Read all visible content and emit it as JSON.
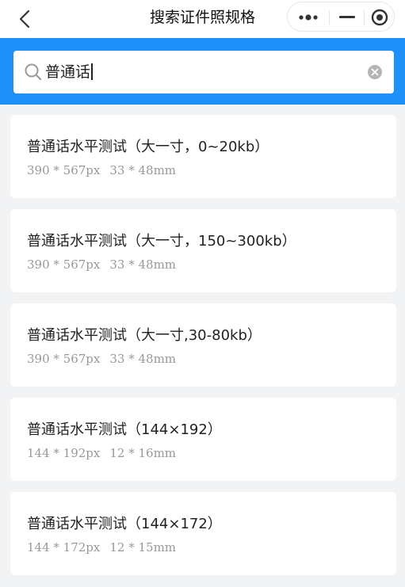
{
  "nav": {
    "title": "搜索证件照规格",
    "back_icon": "chevron-left-icon",
    "capsule_icons": [
      "more-dots-icon",
      "minimize-icon",
      "close-target-icon"
    ]
  },
  "search": {
    "query": "普通话",
    "search_icon": "search-icon",
    "clear_icon": "clear-icon",
    "band_color": "#1e90f8"
  },
  "results": [
    {
      "title": "普通话水平测试（大一寸，0~20kb）",
      "px": "390 * 567px",
      "mm": "33 * 48mm"
    },
    {
      "title": "普通话水平测试（大一寸，150~300kb）",
      "px": "390 * 567px",
      "mm": "33 * 48mm"
    },
    {
      "title": "普通话水平测试（大一寸,30-80kb）",
      "px": "390 * 567px",
      "mm": "33 * 48mm"
    },
    {
      "title": "普通话水平测试（144×192）",
      "px": "144 * 192px",
      "mm": "12 * 16mm"
    },
    {
      "title": "普通话水平测试（144×172）",
      "px": "144 * 172px",
      "mm": "12 * 15mm"
    }
  ]
}
